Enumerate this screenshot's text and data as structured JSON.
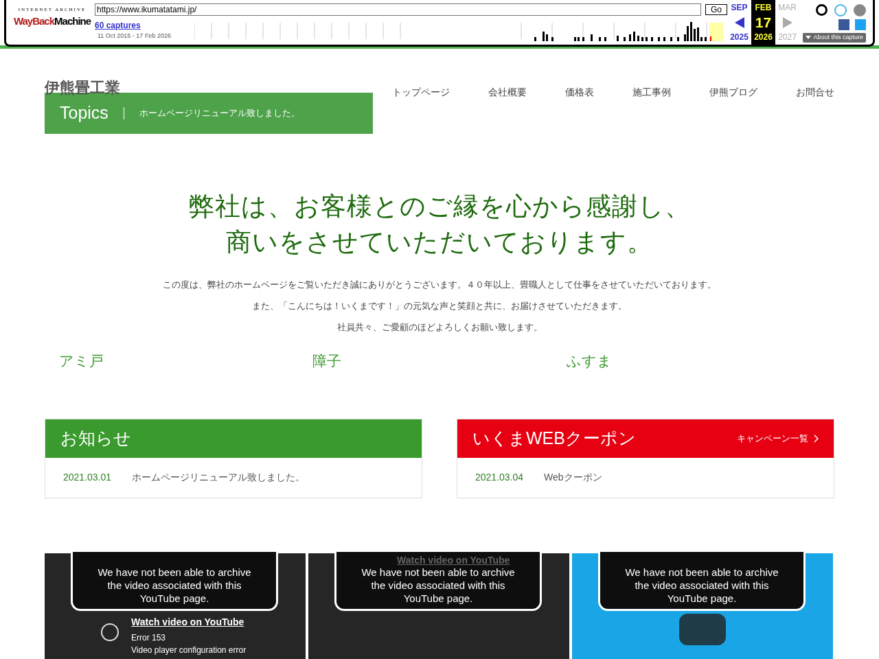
{
  "wayback": {
    "brand_top": "INTERNET ARCHIVE",
    "brand_a": "WayBack",
    "brand_b": "Machine",
    "url": "https://www.ikumatatami.jp/",
    "go": "Go",
    "captures": "60 captures",
    "range": "11 Oct 2015 - 17 Feb 2026",
    "months": [
      {
        "month": "SEP",
        "year": "2025",
        "selected": false
      },
      {
        "month": "FEB",
        "day": "17",
        "year": "2026",
        "selected": true
      },
      {
        "month": "MAR",
        "year": "2027",
        "selected": false
      }
    ],
    "about": "About this capture"
  },
  "header": {
    "logo_alt": "伊熊畳工業",
    "nav": [
      "トップページ",
      "会社概要",
      "価格表",
      "施工事例",
      "伊熊ブログ",
      "お問合せ"
    ]
  },
  "topics": {
    "label": "Topics",
    "text": "ホームページリニューアル致しました。"
  },
  "hero": {
    "lines": [
      "弊社は、お客様とのご縁を心から感謝し、",
      "商いをさせていただいております。"
    ],
    "paragraphs": [
      "この度は、弊社のホームページをご覧いただき誠にありがとうございます。４０年以上、畳職人として仕事をさせていただいております。",
      "また、「こんにちは！いくまです！」の元気な声と笑顔と共に、お届けさせていただきます。",
      "社員共々、ご愛顧のほどよろしくお願い致します。"
    ]
  },
  "services": [
    "アミ戸",
    "障子",
    "ふすま"
  ],
  "panels": [
    {
      "title": "お知らせ",
      "color": "#3a9a2e",
      "items": [
        {
          "date": "2021.03.01",
          "text": "ホームページリニューアル致しました。"
        }
      ]
    },
    {
      "title": "いくまWEBクーポン",
      "color": "#e60012",
      "link": "キャンペーン一覧",
      "items": [
        {
          "date": "2021.03.04",
          "text": "Webクーポン"
        }
      ]
    }
  ],
  "videos": [
    {
      "kind": "error",
      "message": "We have not been able to archive the video associated with this YouTube page.",
      "watch": "Watch video on YouTube",
      "error": "Error 153",
      "detail": "Video player configuration error"
    },
    {
      "kind": "error_top",
      "message": "We have not been able to archive the video associated with this YouTube page.",
      "watch": "Watch video on YouTube"
    },
    {
      "kind": "thumbnail",
      "message": "We have not been able to archive the video associated with this YouTube page."
    }
  ]
}
